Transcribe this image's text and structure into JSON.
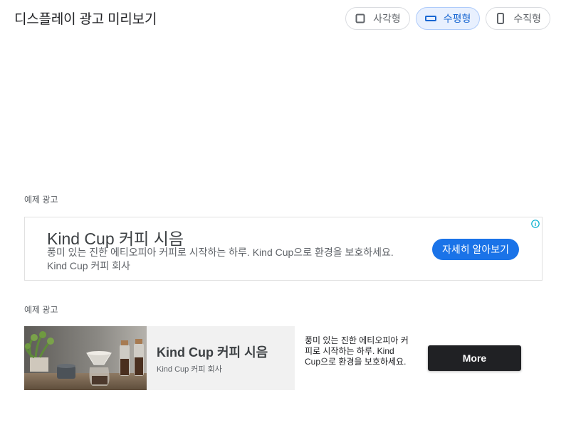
{
  "header": {
    "title": "디스플레이 광고 미리보기",
    "layout_options": [
      {
        "label": "사각형",
        "icon": "square-icon",
        "active": false
      },
      {
        "label": "수평형",
        "icon": "horizontal-rectangle-icon",
        "active": true
      },
      {
        "label": "수직형",
        "icon": "vertical-rectangle-icon",
        "active": false
      }
    ]
  },
  "text_ad": {
    "section_label": "예제 광고",
    "headline": "Kind Cup 커피 시음",
    "description": "풍미 있는 진한 에티오피아 커피로 시작하는 하루. Kind Cup으로 환경을 보호하세요. Kind Cup 커피 회사",
    "cta": "자세히 알아보기",
    "info_icon": "info-icon"
  },
  "image_ad": {
    "section_label": "예제 광고",
    "headline": "Kind Cup 커피 시음",
    "advertiser": "Kind Cup 커피 회사",
    "description": "풍미 있는 진한 에티오피아 커피로 시작하는 하루. Kind Cup으로 환경을 보호하세요.",
    "cta": "More"
  },
  "colors": {
    "accent": "#1a73e8",
    "active_toggle_bg": "#e8f0fe",
    "dark_button": "#202124"
  }
}
